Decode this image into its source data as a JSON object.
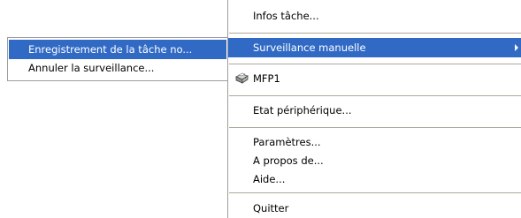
{
  "main_menu": {
    "info": "Infos tâche...",
    "monitor": "Surveillance manuelle",
    "device_name": "MFP1",
    "device_state": "Etat périphérique...",
    "settings": "Paramètres...",
    "about": "A propos de...",
    "help": "Aide...",
    "quit": "Quitter"
  },
  "submenu": {
    "record": "Enregistrement de la tâche no...",
    "cancel": "Annuler la surveillance..."
  },
  "colors": {
    "highlight": "#316ac5",
    "separator": "#aca899",
    "border": "#9d9d9d"
  },
  "icons": {
    "printer": "printer-icon",
    "submenu_arrow": "submenu-arrow-icon"
  }
}
